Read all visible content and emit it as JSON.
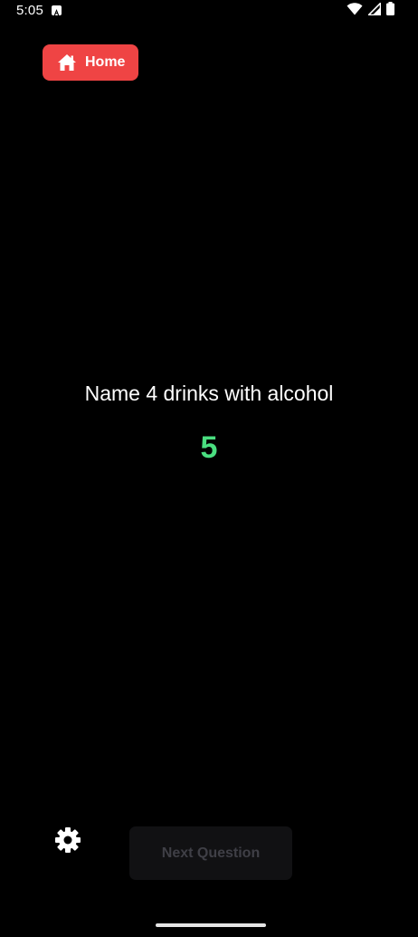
{
  "status_bar": {
    "time": "5:05",
    "icons": [
      "a-notification-icon",
      "wifi-icon",
      "signal-icon",
      "battery-icon"
    ]
  },
  "header": {
    "home_label": "Home",
    "home_icon": "house-icon",
    "home_color": "#ef4444"
  },
  "main": {
    "question": "Name 4 drinks with alcohol",
    "timer": "5",
    "timer_color": "#4ade80"
  },
  "footer": {
    "settings_icon": "gear-icon",
    "next_label": "Next Question"
  }
}
